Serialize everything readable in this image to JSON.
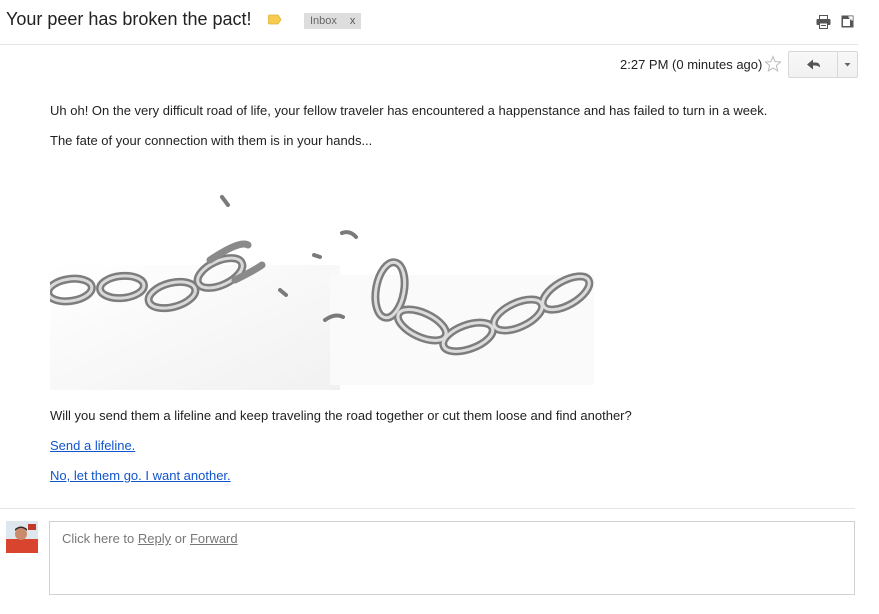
{
  "email": {
    "subject": "Your peer has broken the pact!",
    "label_chip": "Inbox",
    "label_chip_close": "x",
    "timestamp": "2:27 PM (0 minutes ago)",
    "body": {
      "line1": "Uh oh! On the very difficult road of life, your fellow traveler has encountered a happenstance and has failed to turn in a week.",
      "line2": "The fate of your connection with them is in your hands...",
      "line3": "Will you send them a lifeline and keep traveling the road together or cut them loose and find another?",
      "link1": "Send a lifeline.",
      "link2": "No, let them go. I want another."
    }
  },
  "reply_box": {
    "prefix": "Click here to",
    "reply_link": "Reply",
    "or": "or",
    "forward_link": "Forward"
  },
  "icons": {
    "label": "label-tag-icon",
    "print": "print-icon",
    "new_window": "new-window-icon",
    "star": "star-icon",
    "reply": "reply-arrow-icon",
    "more": "dropdown-arrow-icon"
  },
  "colors": {
    "label_tag": "#f7cb4d",
    "link": "#1155cc",
    "chip_bg": "#dddddd"
  }
}
